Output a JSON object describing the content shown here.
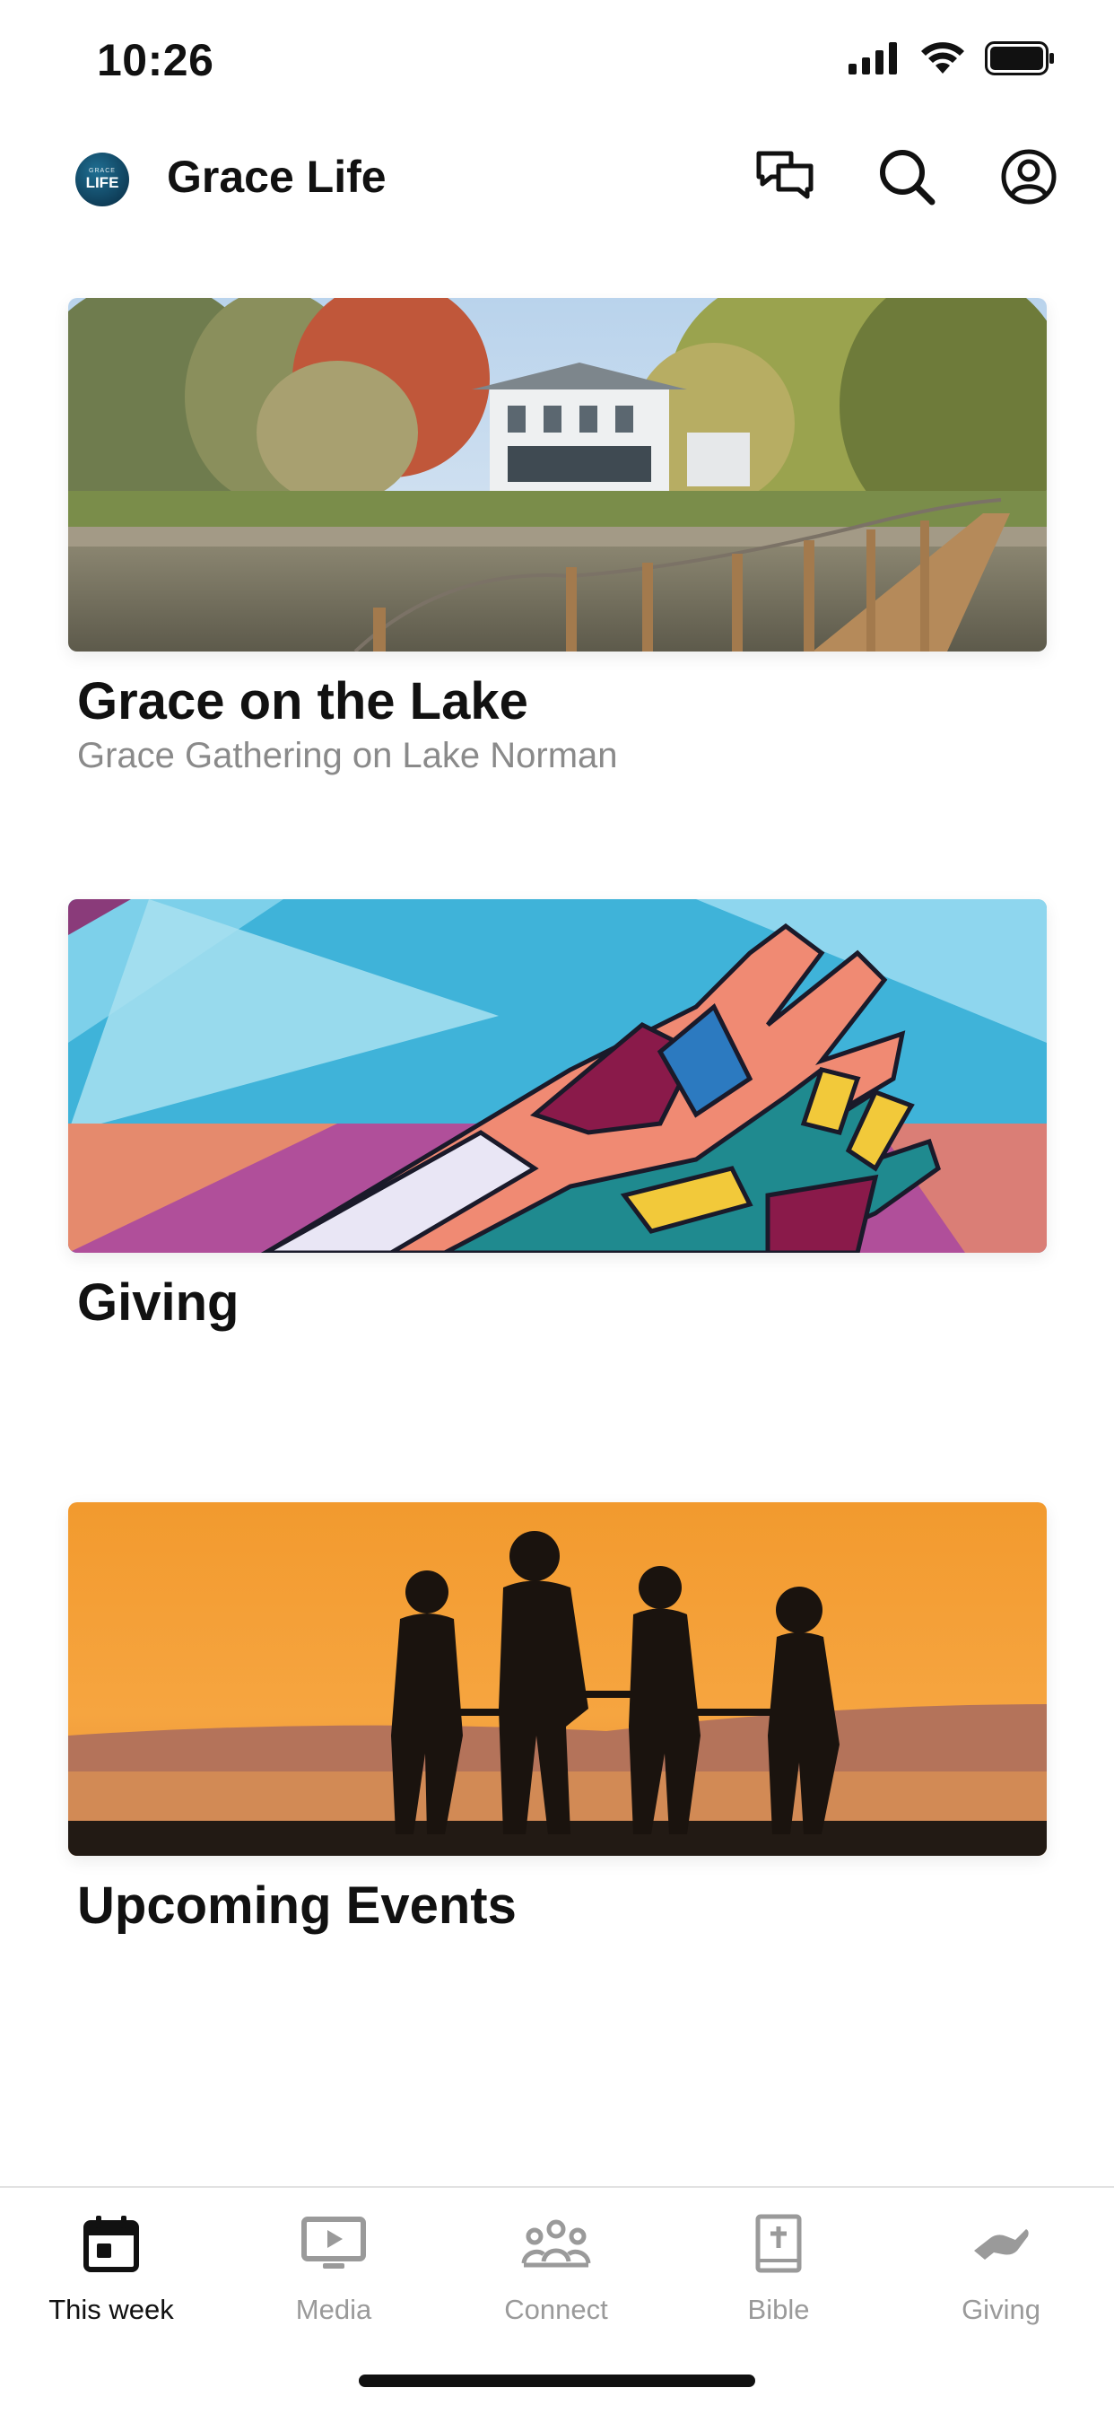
{
  "status_bar": {
    "time": "10:26"
  },
  "header": {
    "logo_top": "GRACE",
    "logo_bottom": "LIFE",
    "title": "Grace Life",
    "icons": [
      "chat-icon",
      "search-icon",
      "profile-icon"
    ]
  },
  "cards": [
    {
      "title": "Grace on the Lake",
      "subtitle": "Grace Gathering on Lake Norman",
      "image": "lake-house-dock-image"
    },
    {
      "title": "Giving",
      "subtitle": "",
      "image": "hands-mural-image"
    },
    {
      "title": "Upcoming Events",
      "subtitle": "",
      "image": "sunset-silhouette-family-image"
    }
  ],
  "tab_bar": {
    "active_index": 0,
    "tabs": [
      {
        "label": "This week",
        "icon": "calendar-icon"
      },
      {
        "label": "Media",
        "icon": "tv-play-icon"
      },
      {
        "label": "Connect",
        "icon": "people-group-icon"
      },
      {
        "label": "Bible",
        "icon": "bible-cross-icon"
      },
      {
        "label": "Giving",
        "icon": "giving-hand-icon"
      }
    ]
  },
  "colors": {
    "active_tab": "#111111",
    "inactive_tab": "#9a9a9a",
    "subtitle": "#8a8a8a",
    "logo_bg": "#0f3f5a"
  }
}
